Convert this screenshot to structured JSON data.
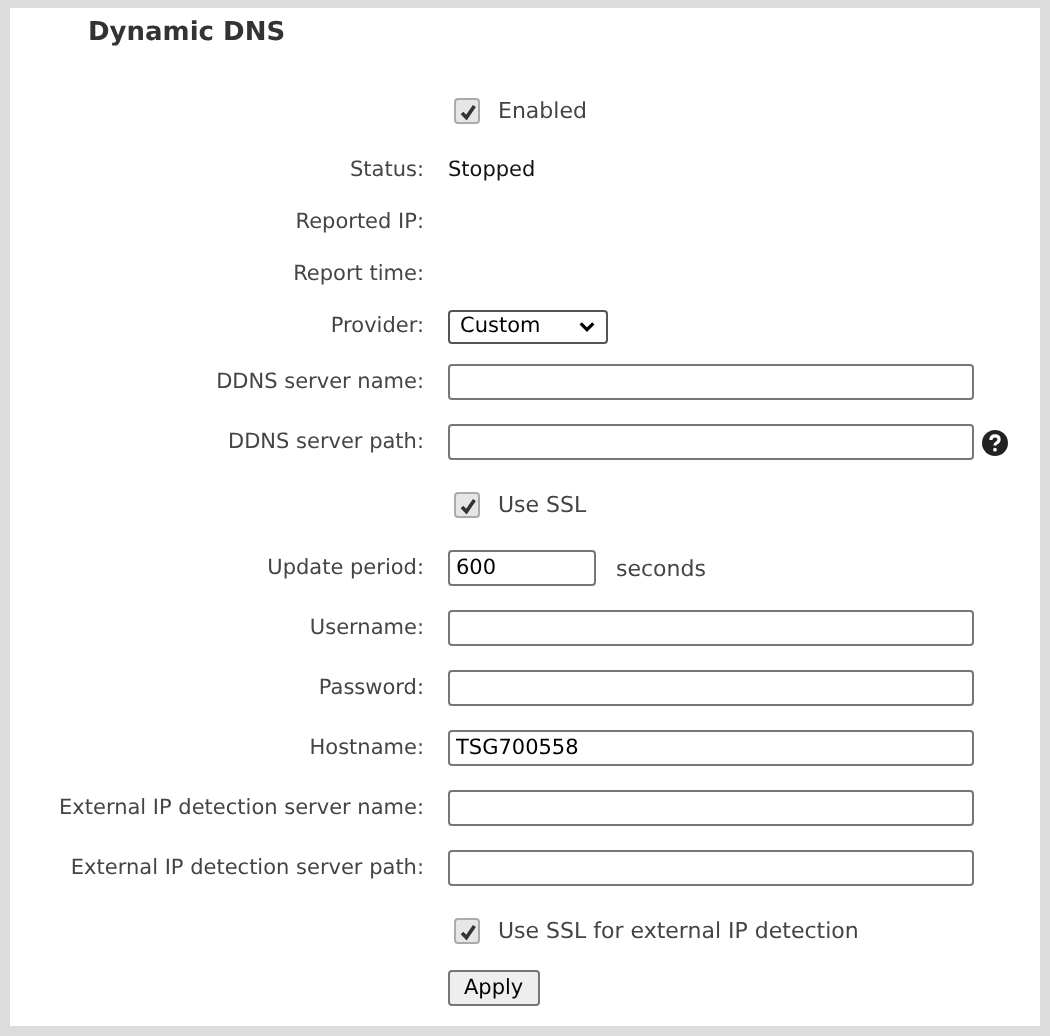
{
  "title": "Dynamic DNS",
  "rows": [
    {
      "kind": "checkbox",
      "label": "Enabled",
      "checked": true
    },
    {
      "kind": "info",
      "label": "Status:",
      "value": "Stopped"
    },
    {
      "kind": "info",
      "label": "Reported IP:"
    },
    {
      "kind": "info",
      "label": "Report time:"
    },
    {
      "kind": "select",
      "label": "Provider:",
      "value": "Custom"
    },
    {
      "kind": "text",
      "label": "DDNS server name:"
    },
    {
      "kind": "text",
      "label": "DDNS server path:",
      "help": true
    },
    {
      "kind": "checkbox",
      "label": "Use SSL",
      "checked": true
    },
    {
      "kind": "short",
      "label": "Update period:",
      "value": "600",
      "suffix": "seconds"
    },
    {
      "kind": "text",
      "label": "Username:"
    },
    {
      "kind": "text",
      "label": "Password:"
    },
    {
      "kind": "text",
      "label": "Hostname:",
      "value": "TSG700558"
    },
    {
      "kind": "text",
      "label": "External IP detection server name:"
    },
    {
      "kind": "text",
      "label": "External IP detection server path:"
    },
    {
      "kind": "checkbox",
      "label": "Use SSL for external IP detection",
      "checked": true
    },
    {
      "kind": "button",
      "label": "Apply"
    }
  ]
}
